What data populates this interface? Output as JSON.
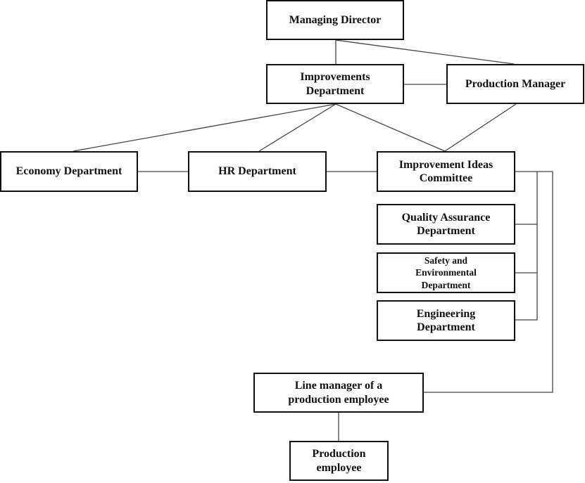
{
  "diagram": {
    "type": "organizational-chart",
    "line_color": "#444444",
    "box_border_color": "#111111",
    "nodes": {
      "managing_director": "Managing Director",
      "improvements_department": "Improvements\nDepartment",
      "production_manager": "Production Manager",
      "economy_department": "Economy Department",
      "hr_department": "HR Department",
      "improvement_ideas_committee": "Improvement Ideas\nCommittee",
      "quality_assurance_department": "Quality Assurance\nDepartment",
      "safety_environmental_department": "Safety and\nEnvironmental\nDepartment",
      "engineering_department": "Engineering\nDepartment",
      "line_manager": "Line manager of a\nproduction  employee",
      "production_employee": "Production\nemployee"
    },
    "connections": [
      [
        "managing_director",
        "improvements_department"
      ],
      [
        "managing_director",
        "production_manager"
      ],
      [
        "improvements_department",
        "production_manager"
      ],
      [
        "improvements_department",
        "economy_department"
      ],
      [
        "improvements_department",
        "hr_department"
      ],
      [
        "improvements_department",
        "improvement_ideas_committee"
      ],
      [
        "production_manager",
        "improvement_ideas_committee"
      ],
      [
        "economy_department",
        "hr_department"
      ],
      [
        "hr_department",
        "improvement_ideas_committee"
      ],
      [
        "improvement_ideas_committee",
        "quality_assurance_department"
      ],
      [
        "improvement_ideas_committee",
        "safety_environmental_department"
      ],
      [
        "improvement_ideas_committee",
        "engineering_department"
      ],
      [
        "improvement_ideas_committee",
        "line_manager"
      ],
      [
        "line_manager",
        "production_employee"
      ]
    ]
  }
}
